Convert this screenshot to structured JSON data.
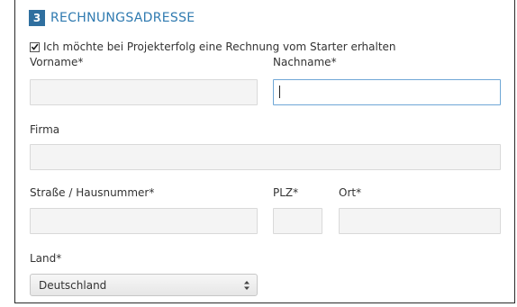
{
  "section": {
    "step_number": "3",
    "title": "RECHNUNGSADRESSE"
  },
  "invoice_checkbox": {
    "label": "Ich möchte bei Projekterfolg eine Rechnung vom Starter erhalten",
    "checked": true
  },
  "fields": {
    "vorname": {
      "label": "Vorname*",
      "value": ""
    },
    "nachname": {
      "label": "Nachname*",
      "value": ""
    },
    "firma": {
      "label": "Firma",
      "value": ""
    },
    "strasse": {
      "label": "Straße / Hausnummer*",
      "value": ""
    },
    "plz": {
      "label": "PLZ*",
      "value": ""
    },
    "ort": {
      "label": "Ort*",
      "value": ""
    },
    "land": {
      "label": "Land*",
      "selected": "Deutschland"
    }
  },
  "colors": {
    "accent": "#2f7ab0",
    "badge": "#2f6f9f",
    "focus_border": "#6fa7d6"
  },
  "icons": {
    "checkbox": "checkmark-icon",
    "select": "updown-arrows-icon"
  }
}
